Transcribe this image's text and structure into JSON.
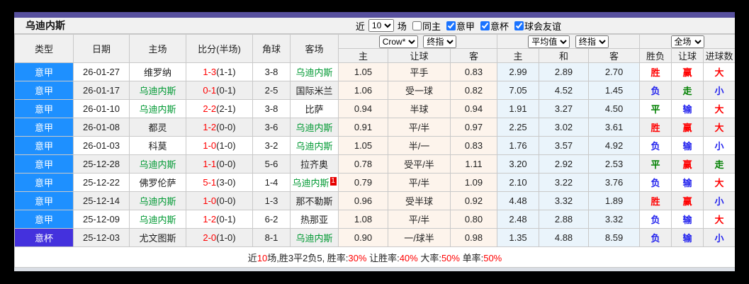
{
  "window": {
    "team_name": "乌迪内斯"
  },
  "controls": {
    "recent_label": "近",
    "recent_value": "10",
    "matches_label": "场",
    "checkboxes": [
      {
        "label": "同主",
        "checked": false
      },
      {
        "label": "意甲",
        "checked": true
      },
      {
        "label": "意杯",
        "checked": true
      },
      {
        "label": "球会友谊",
        "checked": true
      }
    ]
  },
  "table": {
    "static_headers": [
      "类型",
      "日期",
      "主场",
      "比分(半场)",
      "角球",
      "客场"
    ],
    "group_handicap": {
      "company_select": "Crow*",
      "stage_select": "终指",
      "sub": [
        "主",
        "让球",
        "客"
      ]
    },
    "group_average": {
      "type_select": "平均值",
      "stage_select": "终指",
      "sub": [
        "主",
        "和",
        "客"
      ]
    },
    "group_result": {
      "scope_select": "全场",
      "sub": [
        "胜负",
        "让球",
        "进球数"
      ]
    },
    "rows": [
      {
        "league": "意甲",
        "date": "26-01-27",
        "home": "维罗纳",
        "home_highlight": false,
        "score": "1-3",
        "half_score": "(1-1)",
        "corners": "3-8",
        "away": "乌迪内斯",
        "away_highlight": true,
        "red_card_badge": "",
        "handicap_odds_home": "1.05",
        "handicap": "平手",
        "handicap_odds_away": "0.83",
        "avg_home": "2.99",
        "avg_draw": "2.89",
        "avg_away": "2.70",
        "result": "胜",
        "handicap_result": "赢",
        "goals_result": "大"
      },
      {
        "league": "意甲",
        "date": "26-01-17",
        "home": "乌迪内斯",
        "home_highlight": true,
        "score": "0-1",
        "half_score": "(0-1)",
        "corners": "2-5",
        "away": "国际米兰",
        "away_highlight": false,
        "red_card_badge": "",
        "handicap_odds_home": "1.06",
        "handicap": "受一球",
        "handicap_odds_away": "0.82",
        "avg_home": "7.05",
        "avg_draw": "4.52",
        "avg_away": "1.45",
        "result": "负",
        "handicap_result": "走",
        "goals_result": "小"
      },
      {
        "league": "意甲",
        "date": "26-01-10",
        "home": "乌迪内斯",
        "home_highlight": true,
        "score": "2-2",
        "half_score": "(2-1)",
        "corners": "3-8",
        "away": "比萨",
        "away_highlight": false,
        "red_card_badge": "",
        "handicap_odds_home": "0.94",
        "handicap": "半球",
        "handicap_odds_away": "0.94",
        "avg_home": "1.91",
        "avg_draw": "3.27",
        "avg_away": "4.50",
        "result": "平",
        "handicap_result": "输",
        "goals_result": "大"
      },
      {
        "league": "意甲",
        "date": "26-01-08",
        "home": "都灵",
        "home_highlight": false,
        "score": "1-2",
        "half_score": "(0-0)",
        "corners": "3-6",
        "away": "乌迪内斯",
        "away_highlight": true,
        "red_card_badge": "",
        "handicap_odds_home": "0.91",
        "handicap": "平/半",
        "handicap_odds_away": "0.97",
        "avg_home": "2.25",
        "avg_draw": "3.02",
        "avg_away": "3.61",
        "result": "胜",
        "handicap_result": "赢",
        "goals_result": "大"
      },
      {
        "league": "意甲",
        "date": "26-01-03",
        "home": "科莫",
        "home_highlight": false,
        "score": "1-0",
        "half_score": "(1-0)",
        "corners": "3-2",
        "away": "乌迪内斯",
        "away_highlight": true,
        "red_card_badge": "",
        "handicap_odds_home": "1.05",
        "handicap": "半/一",
        "handicap_odds_away": "0.83",
        "avg_home": "1.76",
        "avg_draw": "3.57",
        "avg_away": "4.92",
        "result": "负",
        "handicap_result": "输",
        "goals_result": "小"
      },
      {
        "league": "意甲",
        "date": "25-12-28",
        "home": "乌迪内斯",
        "home_highlight": true,
        "score": "1-1",
        "half_score": "(0-0)",
        "corners": "5-6",
        "away": "拉齐奥",
        "away_highlight": false,
        "red_card_badge": "",
        "handicap_odds_home": "0.78",
        "handicap": "受平/半",
        "handicap_odds_away": "1.11",
        "avg_home": "3.20",
        "avg_draw": "2.92",
        "avg_away": "2.53",
        "result": "平",
        "handicap_result": "赢",
        "goals_result": "走"
      },
      {
        "league": "意甲",
        "date": "25-12-22",
        "home": "佛罗伦萨",
        "home_highlight": false,
        "score": "5-1",
        "half_score": "(3-0)",
        "corners": "1-4",
        "away": "乌迪内斯",
        "away_highlight": true,
        "red_card_badge": "1",
        "handicap_odds_home": "0.79",
        "handicap": "平/半",
        "handicap_odds_away": "1.09",
        "avg_home": "2.10",
        "avg_draw": "3.22",
        "avg_away": "3.76",
        "result": "负",
        "handicap_result": "输",
        "goals_result": "大"
      },
      {
        "league": "意甲",
        "date": "25-12-14",
        "home": "乌迪内斯",
        "home_highlight": true,
        "score": "1-0",
        "half_score": "(0-0)",
        "corners": "1-3",
        "away": "那不勒斯",
        "away_highlight": false,
        "red_card_badge": "",
        "handicap_odds_home": "0.96",
        "handicap": "受半球",
        "handicap_odds_away": "0.92",
        "avg_home": "4.48",
        "avg_draw": "3.32",
        "avg_away": "1.89",
        "result": "胜",
        "handicap_result": "赢",
        "goals_result": "小"
      },
      {
        "league": "意甲",
        "date": "25-12-09",
        "home": "乌迪内斯",
        "home_highlight": true,
        "score": "1-2",
        "half_score": "(0-1)",
        "corners": "6-2",
        "away": "热那亚",
        "away_highlight": false,
        "red_card_badge": "",
        "handicap_odds_home": "1.08",
        "handicap": "平/半",
        "handicap_odds_away": "0.80",
        "avg_home": "2.48",
        "avg_draw": "2.88",
        "avg_away": "3.32",
        "result": "负",
        "handicap_result": "输",
        "goals_result": "大"
      },
      {
        "league": "意杯",
        "date": "25-12-03",
        "home": "尤文图斯",
        "home_highlight": false,
        "score": "2-0",
        "half_score": "(1-0)",
        "corners": "8-1",
        "away": "乌迪内斯",
        "away_highlight": true,
        "red_card_badge": "",
        "handicap_odds_home": "0.90",
        "handicap": "一/球半",
        "handicap_odds_away": "0.98",
        "avg_home": "1.35",
        "avg_draw": "4.88",
        "avg_away": "8.59",
        "result": "负",
        "handicap_result": "输",
        "goals_result": "小"
      }
    ]
  },
  "footer": {
    "segments": [
      {
        "text": "近",
        "red": false
      },
      {
        "text": "10",
        "red": true
      },
      {
        "text": "场,胜3平2负5, 胜率:",
        "red": false
      },
      {
        "text": "30%",
        "red": true
      },
      {
        "text": " 让胜率:",
        "red": false
      },
      {
        "text": "40%",
        "red": true
      },
      {
        "text": " 大率:",
        "red": false
      },
      {
        "text": "50%",
        "red": true
      },
      {
        "text": " 单率:",
        "red": false
      },
      {
        "text": "50%",
        "red": true
      }
    ]
  },
  "colors": {
    "accent_bar": "#57509e",
    "score_red": "#ff0000",
    "team_highlight_green": "#009933",
    "league_colors": {
      "意甲": "#1e90ff",
      "意杯": "#4431dd"
    },
    "outcome_colors": {
      "胜": "#ff0000",
      "赢": "#ff0000",
      "大": "#ff0000",
      "负": "#2222ee",
      "输": "#2222ee",
      "小": "#2222ee",
      "平": "#008000",
      "走": "#008000"
    }
  }
}
